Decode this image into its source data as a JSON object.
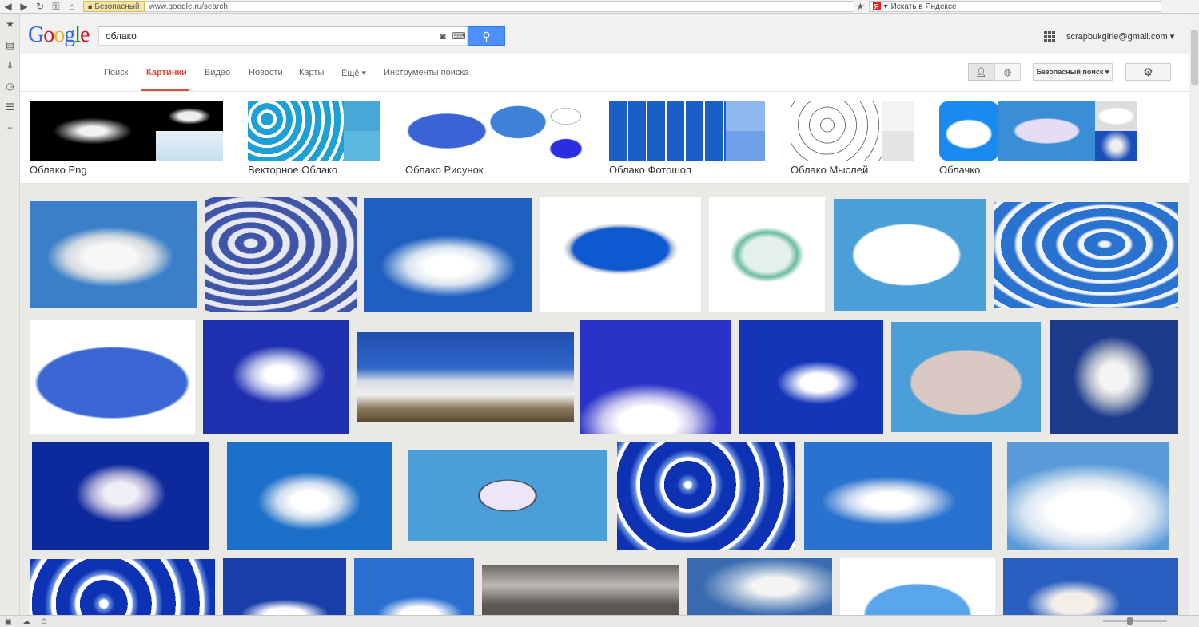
{
  "browser": {
    "secure_label": "Безопасный",
    "url": "www.google.ru/search",
    "yandex_placeholder": "Искать в Яндексе",
    "yandex_logo": "Я"
  },
  "google": {
    "logo_letters": [
      "G",
      "o",
      "o",
      "g",
      "l",
      "e"
    ],
    "logo_colors": [
      "#3369e8",
      "#d50f25",
      "#eeb211",
      "#3369e8",
      "#009925",
      "#d50f25"
    ],
    "query": "облако",
    "account": "scrapbukgirle@gmail.com ▾",
    "tabs": [
      "Поиск",
      "Картинки",
      "Видео",
      "Новости",
      "Карты",
      "Ещё ▾",
      "Инструменты поиска"
    ],
    "active_tab": "Картинки",
    "safe_search": "Безопасный поиск ▾"
  },
  "related": [
    {
      "caption": "Облако Png"
    },
    {
      "caption": "Векторное Облако"
    },
    {
      "caption": "Облако Рисунок"
    },
    {
      "caption": "Облако Фотошоп"
    },
    {
      "caption": "Облако Мыслей"
    },
    {
      "caption": "Облачко"
    }
  ],
  "icons": {
    "back": "back-arrow-icon",
    "forward": "forward-arrow-icon",
    "reload": "reload-icon",
    "key": "key-icon",
    "home": "home-icon",
    "lock": "lock-icon",
    "star": "bookmark-star-icon",
    "camera": "camera-icon",
    "keyboard": "keyboard-icon",
    "search": "search-icon",
    "apps": "apps-grid-icon",
    "person": "person-icon",
    "globe": "globe-icon",
    "gear": "gear-icon"
  },
  "colors": {
    "accent_red": "#dd4b39",
    "search_blue": "#4d90fe",
    "sky_blue": "#1d5fc4",
    "deep_blue": "#0b2fa3"
  }
}
